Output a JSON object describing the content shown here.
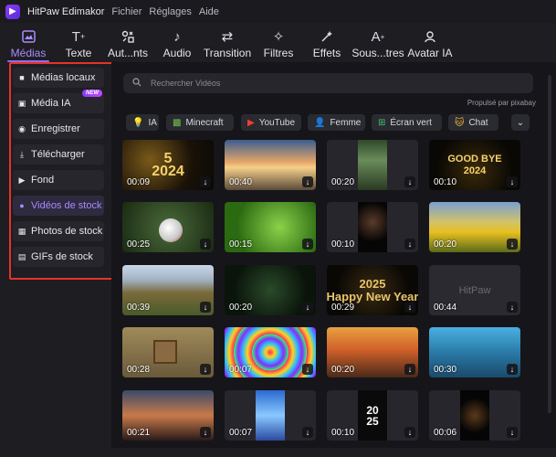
{
  "titlebar": {
    "app_title": "HitPaw Edimakor",
    "menu": [
      "Fichier",
      "Réglages",
      "Aide"
    ]
  },
  "toolbar": [
    {
      "label": "Médias",
      "icon": "media-icon",
      "active": true
    },
    {
      "label": "Texte",
      "icon": "text-icon"
    },
    {
      "label": "Aut...nts",
      "icon": "elements-icon"
    },
    {
      "label": "Audio",
      "icon": "music-note-icon"
    },
    {
      "label": "Transition",
      "icon": "transition-arrows-icon"
    },
    {
      "label": "Filtres",
      "icon": "sparkle-icon"
    },
    {
      "label": "Effets",
      "icon": "effects-icon"
    },
    {
      "label": "Sous...tres",
      "icon": "subtitle-icon"
    },
    {
      "label": "Avatar IA",
      "icon": "avatar-icon"
    }
  ],
  "sidebar": {
    "items": [
      {
        "label": "Médias locaux",
        "icon": "folder-icon"
      },
      {
        "label": "Média IA",
        "icon": "ai-media-icon",
        "badge": "NEW"
      },
      {
        "label": "Enregistrer",
        "icon": "record-icon"
      },
      {
        "label": "Télécharger",
        "icon": "download-icon"
      },
      {
        "label": "Fond",
        "icon": "arrow-right-icon"
      },
      {
        "label": "Vidéos de stock",
        "icon": "stock-video-icon",
        "active": true
      },
      {
        "label": "Photos de stock",
        "icon": "photo-icon"
      },
      {
        "label": "GIFs de stock",
        "icon": "gif-icon"
      }
    ]
  },
  "search": {
    "placeholder": "Rechercher Vidéos"
  },
  "powered_by": "Propulsé par pixabay",
  "chips": [
    {
      "label": "IA",
      "icon": "bulb-icon"
    },
    {
      "label": "Minecraft",
      "icon": "minecraft-icon"
    },
    {
      "label": "YouTube",
      "icon": "youtube-icon"
    },
    {
      "label": "Femme",
      "icon": "person-icon"
    },
    {
      "label": "Écran vert",
      "icon": "green-screen-icon"
    },
    {
      "label": "Chat",
      "icon": "cat-icon"
    }
  ],
  "videos": [
    {
      "duration": "00:09",
      "overlay_text": "5\n2024"
    },
    {
      "duration": "00:40"
    },
    {
      "duration": "00:20"
    },
    {
      "duration": "00:10",
      "overlay_text": "GOOD BYE\n2024"
    },
    {
      "duration": "00:25"
    },
    {
      "duration": "00:15"
    },
    {
      "duration": "00:10"
    },
    {
      "duration": "00:20"
    },
    {
      "duration": "00:39"
    },
    {
      "duration": "00:20"
    },
    {
      "duration": "00:29",
      "overlay_text": "2025\nHappy New Year"
    },
    {
      "duration": "00:44",
      "overlay_text": "HitPaw"
    },
    {
      "duration": "00:28"
    },
    {
      "duration": "00:07"
    },
    {
      "duration": "00:20"
    },
    {
      "duration": "00:30"
    },
    {
      "duration": "00:21"
    },
    {
      "duration": "00:07"
    },
    {
      "duration": "00:10",
      "overlay_text": "20\n25"
    },
    {
      "duration": "00:06"
    }
  ],
  "colors": {
    "accent": "#8e6cff",
    "highlight_box": "#e5332a",
    "background": "#16161a",
    "panel": "#1d1d22"
  }
}
